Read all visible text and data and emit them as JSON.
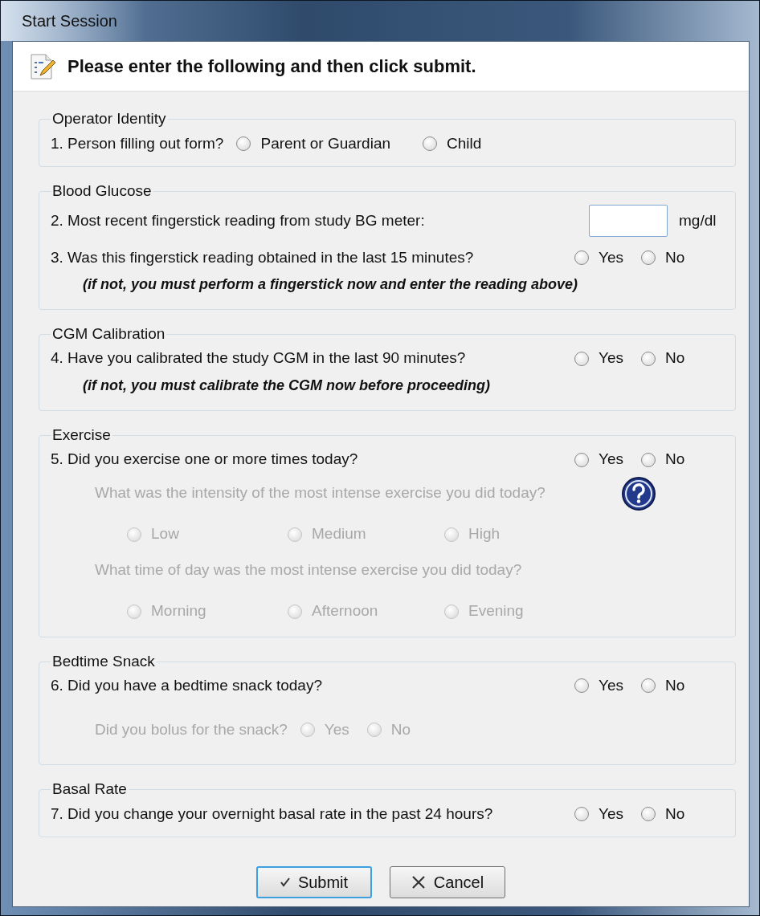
{
  "window": {
    "title": "Start Session"
  },
  "header": {
    "text": "Please enter the following and then click submit."
  },
  "groups": [
    {
      "legend": "Operator Identity",
      "rows": [
        {
          "kind": "inline",
          "text": "1.  Person filling out form?",
          "disabled": false,
          "options": [
            {
              "label": "Parent or Guardian",
              "selected": false
            },
            {
              "label": "Child",
              "selected": false
            }
          ]
        }
      ]
    },
    {
      "legend": "Blood Glucose",
      "rows": [
        {
          "kind": "input",
          "text": "2.  Most recent fingerstick reading from study BG meter:",
          "disabled": false,
          "unit": "mg/dl"
        },
        {
          "kind": "question",
          "text": "3.  Was this fingerstick reading obtained in the last 15 minutes?",
          "disabled": false,
          "options": [
            {
              "label": "Yes",
              "selected": false
            },
            {
              "label": "No",
              "selected": false
            }
          ]
        },
        {
          "kind": "note",
          "text": "(if not, you must perform a fingerstick now and enter the reading above)",
          "disabled": false
        }
      ]
    },
    {
      "legend": "CGM Calibration",
      "rows": [
        {
          "kind": "question",
          "text": "4.  Have you calibrated the study CGM in the last 90 minutes?",
          "disabled": false,
          "options": [
            {
              "label": "Yes",
              "selected": false
            },
            {
              "label": "No",
              "selected": false
            }
          ]
        },
        {
          "kind": "note",
          "text": "(if not, you must calibrate the CGM now before proceeding)",
          "disabled": false
        }
      ]
    },
    {
      "legend": "Exercise",
      "rows": [
        {
          "kind": "question",
          "text": "5.  Did you exercise one or more times today?",
          "disabled": false,
          "options": [
            {
              "label": "Yes",
              "selected": false
            },
            {
              "label": "No",
              "selected": false
            }
          ]
        },
        {
          "kind": "choice",
          "text": "What was the intensity of the most intense exercise you did today?",
          "disabled": true,
          "help": true,
          "options": [
            {
              "label": "Low",
              "selected": false
            },
            {
              "label": "Medium",
              "selected": false
            },
            {
              "label": "High",
              "selected": false
            }
          ]
        },
        {
          "kind": "choice",
          "text": "What time of day was the most intense exercise you did today?",
          "disabled": true,
          "options": [
            {
              "label": "Morning",
              "selected": false
            },
            {
              "label": "Afternoon",
              "selected": false
            },
            {
              "label": "Evening",
              "selected": false
            }
          ]
        }
      ]
    },
    {
      "legend": "Bedtime Snack",
      "rows": [
        {
          "kind": "question",
          "text": "6.  Did you have a bedtime snack today?",
          "disabled": false,
          "options": [
            {
              "label": "Yes",
              "selected": false
            },
            {
              "label": "No",
              "selected": false
            }
          ]
        },
        {
          "kind": "subinline",
          "text": "Did you bolus for the snack?",
          "disabled": true,
          "options": [
            {
              "label": "Yes",
              "selected": false
            },
            {
              "label": "No",
              "selected": false
            }
          ]
        }
      ]
    },
    {
      "legend": "Basal Rate",
      "rows": [
        {
          "kind": "question",
          "text": "7.  Did you change your overnight basal rate in the past 24 hours?",
          "disabled": false,
          "options": [
            {
              "label": "Yes",
              "selected": false
            },
            {
              "label": "No",
              "selected": false
            }
          ]
        }
      ]
    }
  ],
  "buttons": [
    {
      "label": "Submit",
      "kind": "submit",
      "focused": true
    },
    {
      "label": "Cancel",
      "kind": "cancel",
      "focused": false
    }
  ]
}
